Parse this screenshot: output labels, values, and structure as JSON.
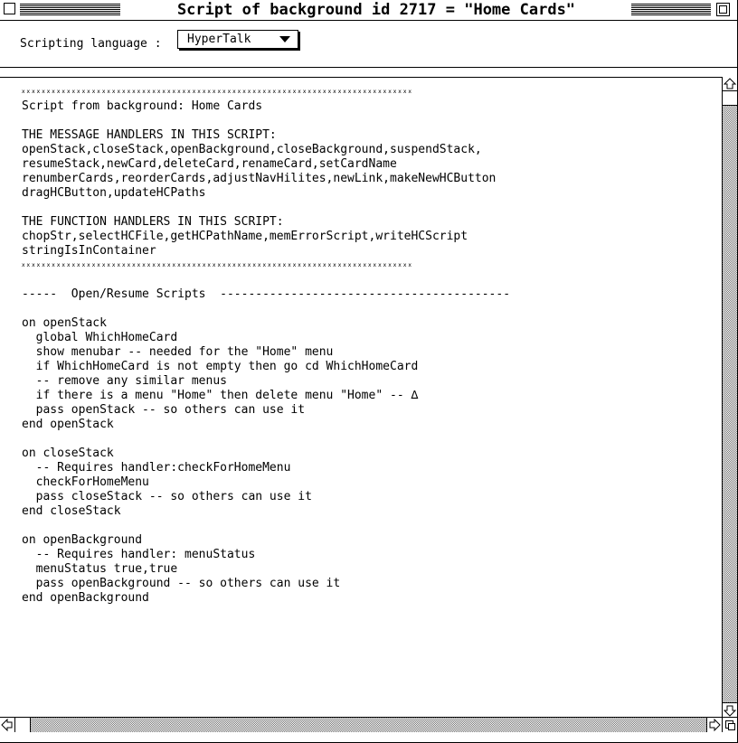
{
  "window": {
    "title": "Script of background id 2717 = \"Home Cards\""
  },
  "language_bar": {
    "label": "Scripting language :",
    "selected": "HyperTalk"
  },
  "script_lines": [
    "ⅹⅹⅹⅹⅹⅹⅹⅹⅹⅹⅹⅹⅹⅹⅹⅹⅹⅹⅹⅹⅹⅹⅹⅹⅹⅹⅹⅹⅹⅹⅹⅹⅹⅹⅹⅹⅹⅹⅹⅹⅹⅹⅹⅹⅹⅹⅹⅹⅹⅹⅹⅹⅹⅹⅹⅹⅹⅹⅹⅹⅹⅹⅹⅹⅹⅹⅹⅹⅹⅹⅹⅹⅹⅹⅹⅹⅹⅹ",
    "Script from background: Home Cards",
    "",
    "THE MESSAGE HANDLERS IN THIS SCRIPT:",
    "openStack,closeStack,openBackground,closeBackground,suspendStack,",
    "resumeStack,newCard,deleteCard,renameCard,setCardName",
    "renumberCards,reorderCards,adjustNavHilites,newLink,makeNewHCButton",
    "dragHCButton,updateHCPaths",
    "",
    "THE FUNCTION HANDLERS IN THIS SCRIPT:",
    "chopStr,selectHCFile,getHCPathName,memErrorScript,writeHCScript",
    "stringIsInContainer",
    "ⅹⅹⅹⅹⅹⅹⅹⅹⅹⅹⅹⅹⅹⅹⅹⅹⅹⅹⅹⅹⅹⅹⅹⅹⅹⅹⅹⅹⅹⅹⅹⅹⅹⅹⅹⅹⅹⅹⅹⅹⅹⅹⅹⅹⅹⅹⅹⅹⅹⅹⅹⅹⅹⅹⅹⅹⅹⅹⅹⅹⅹⅹⅹⅹⅹⅹⅹⅹⅹⅹⅹⅹⅹⅹⅹⅹⅹⅹ",
    "",
    "-----  Open/Resume Scripts  -----------------------------------------",
    "",
    "on openStack",
    "  global WhichHomeCard",
    "  show menubar -- needed for the \"Home\" menu",
    "  if WhichHomeCard is not empty then go cd WhichHomeCard",
    "  -- remove any similar menus",
    "  if there is a menu \"Home\" then delete menu \"Home\" -- ∆",
    "  pass openStack -- so others can use it",
    "end openStack",
    "",
    "on closeStack",
    "  -- Requires handler:checkForHomeMenu",
    "  checkForHomeMenu",
    "  pass closeStack -- so others can use it",
    "end closeStack",
    "",
    "on openBackground",
    "  -- Requires handler: menuStatus",
    "  menuStatus true,true",
    "  pass openBackground -- so others can use it",
    "end openBackground"
  ]
}
